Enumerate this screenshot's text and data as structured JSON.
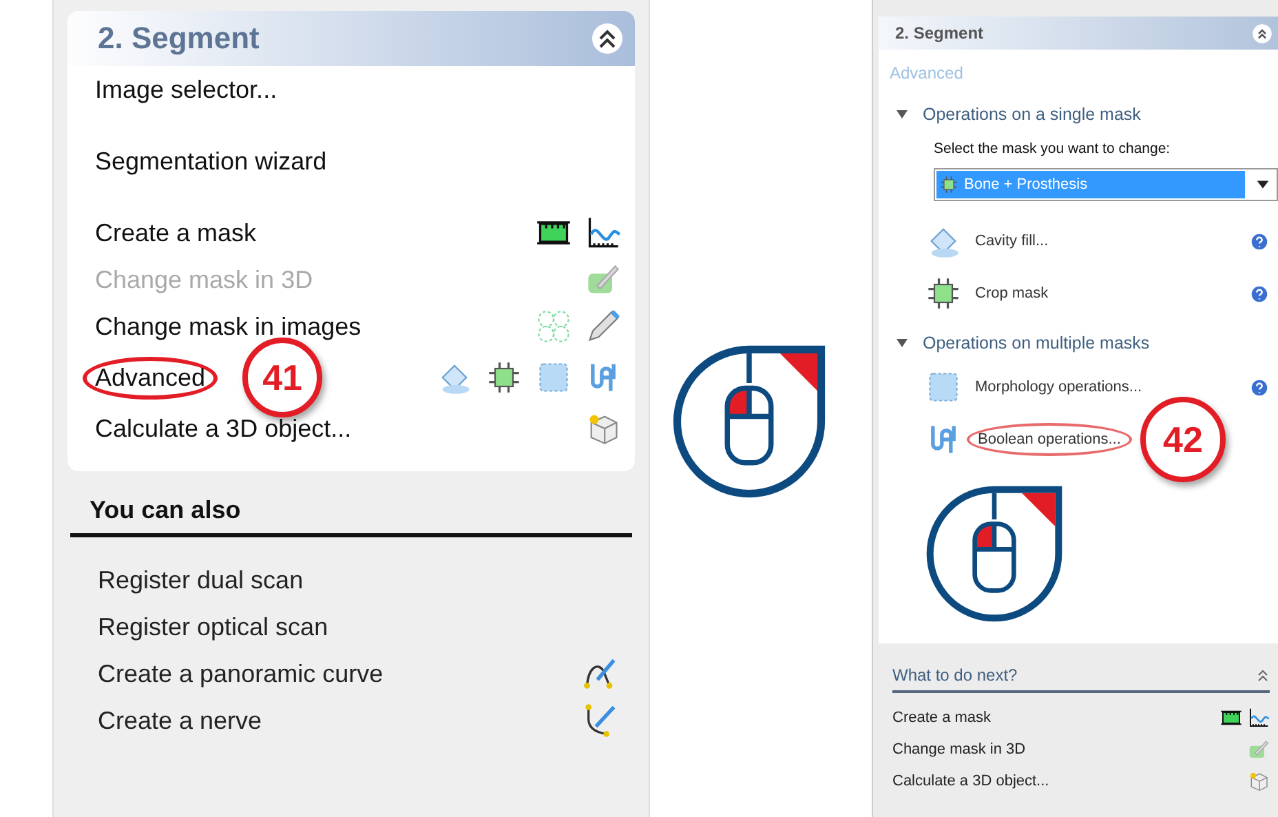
{
  "left_panel": {
    "title": "2. Segment",
    "items": [
      {
        "label": "Image selector...",
        "disabled": false,
        "circled": false
      },
      {
        "label": "Segmentation wizard",
        "disabled": false,
        "circled": false
      },
      {
        "label": "Create a mask",
        "disabled": false,
        "circled": false
      },
      {
        "label": "Change mask in 3D",
        "disabled": true,
        "circled": false
      },
      {
        "label": "Change mask in images",
        "disabled": false,
        "circled": false
      },
      {
        "label": "Advanced",
        "disabled": false,
        "circled": true,
        "callout": "41"
      },
      {
        "label": "Calculate a 3D object...",
        "disabled": false,
        "circled": false
      }
    ],
    "also": {
      "title": "You can also",
      "items": [
        {
          "label": "Register dual scan"
        },
        {
          "label": "Register optical scan"
        },
        {
          "label": "Create a panoramic curve"
        },
        {
          "label": "Create a nerve"
        }
      ]
    }
  },
  "right_panel": {
    "title": "2. Segment",
    "link": "Advanced",
    "groups": [
      {
        "title": "Operations on a single mask",
        "expanded": true,
        "prompt": "Select the mask you want to change:",
        "dropdown": {
          "value": "Bone + Prosthesis"
        },
        "items": [
          {
            "label": "Cavity fill...",
            "circled": false
          },
          {
            "label": "Crop mask",
            "circled": false
          }
        ]
      },
      {
        "title": "Operations on multiple masks",
        "expanded": true,
        "items": [
          {
            "label": "Morphology operations...",
            "circled": false
          },
          {
            "label": "Boolean operations...",
            "circled": true,
            "callout": "42"
          }
        ]
      }
    ],
    "next": {
      "title": "What to do next?",
      "items": [
        {
          "label": "Create a mask"
        },
        {
          "label": "Change mask in 3D"
        },
        {
          "label": "Calculate a 3D object..."
        }
      ]
    }
  }
}
